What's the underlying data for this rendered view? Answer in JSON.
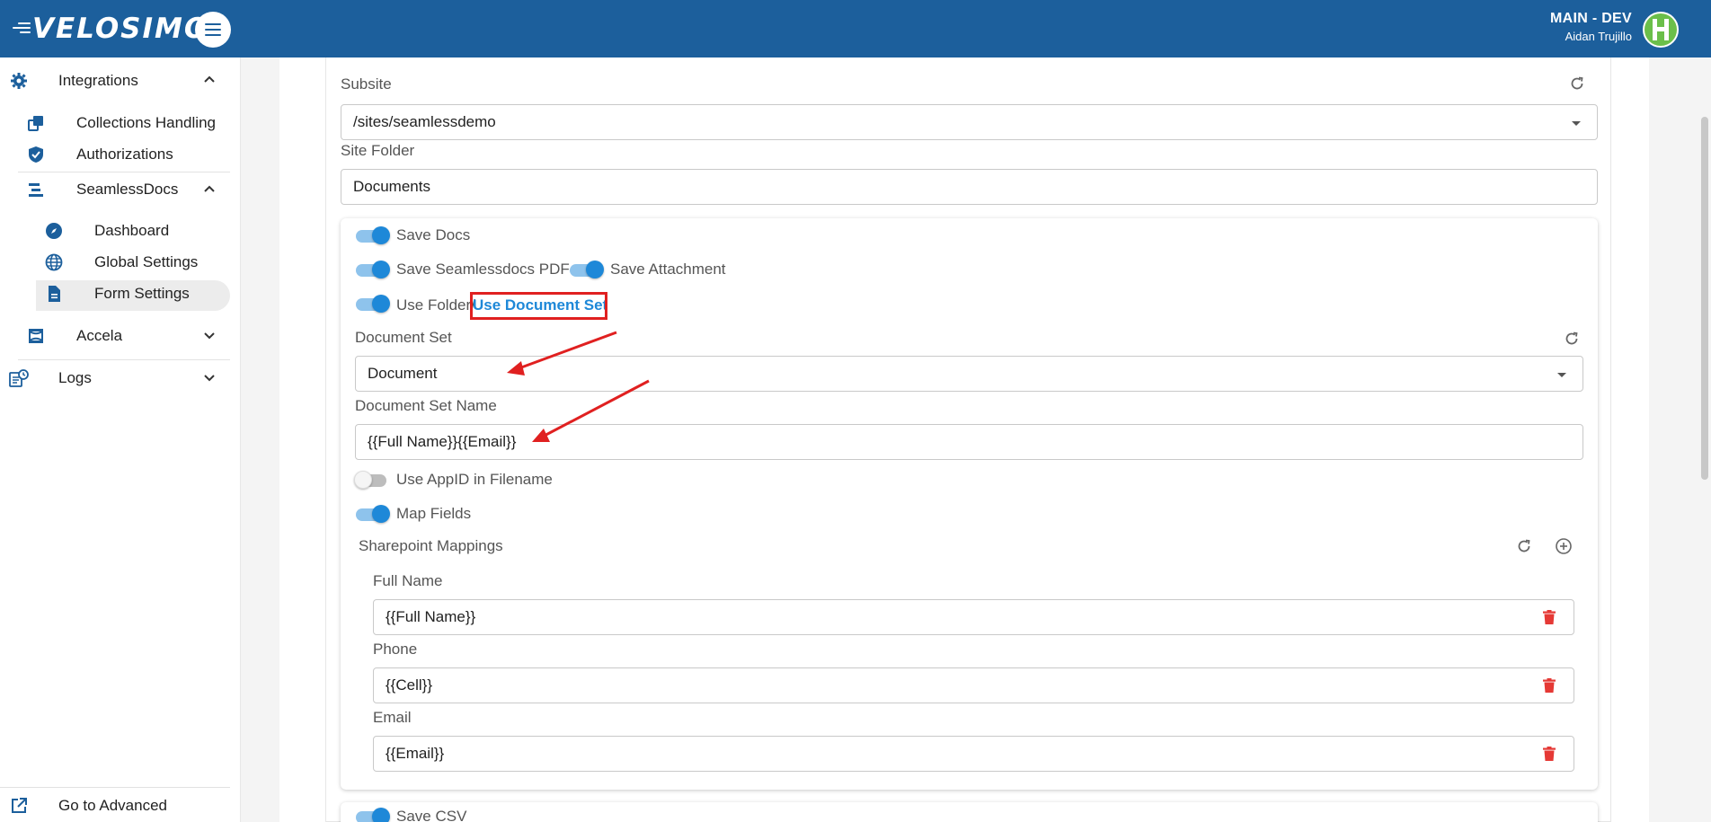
{
  "header": {
    "brand": "VELOSIMO",
    "env_title": "MAIN - DEV",
    "user_name": "Aidan Trujillo",
    "brand_color": "#1c5f9c"
  },
  "sidebar": {
    "integrations": "Integrations",
    "collections_handling": "Collections Handling",
    "authorizations": "Authorizations",
    "seamlessdocs": "SeamlessDocs",
    "dashboard": "Dashboard",
    "global_settings": "Global Settings",
    "form_settings": "Form Settings",
    "accela": "Accela",
    "logs": "Logs",
    "go_advanced": "Go to Advanced",
    "active_item": "Form Settings"
  },
  "form": {
    "subsite_label": "Subsite",
    "subsite_value": "/sites/seamlessdemo",
    "site_folder_label": "Site Folder",
    "site_folder_value": "Documents",
    "save_docs": "Save Docs",
    "save_pdf": "Save Seamlessdocs PDF",
    "save_attachment": "Save Attachment",
    "use_folder": "Use Folder/",
    "use_document_set": "Use Document Set",
    "document_set_label": "Document Set",
    "document_set_value": "Document",
    "document_set_name_label": "Document Set Name",
    "document_set_name_value": "{{Full Name}}{{Email}}",
    "use_appid": "Use AppID in Filename",
    "map_fields": "Map Fields",
    "sharepoint_mappings": "Sharepoint Mappings",
    "save_csv": "Save CSV",
    "toggles": {
      "save_docs": true,
      "save_pdf": true,
      "save_attachment": true,
      "use_folder": true,
      "use_appid": false,
      "map_fields": true,
      "save_csv": true
    }
  },
  "mappings": [
    {
      "label": "Full Name",
      "value": "{{Full Name}}"
    },
    {
      "label": "Phone",
      "value": "{{Cell}}"
    },
    {
      "label": "Email",
      "value": "{{Email}}"
    }
  ],
  "annotation_color": "#e02020",
  "accent_color": "#1e88d8",
  "delete_color": "#e53935"
}
